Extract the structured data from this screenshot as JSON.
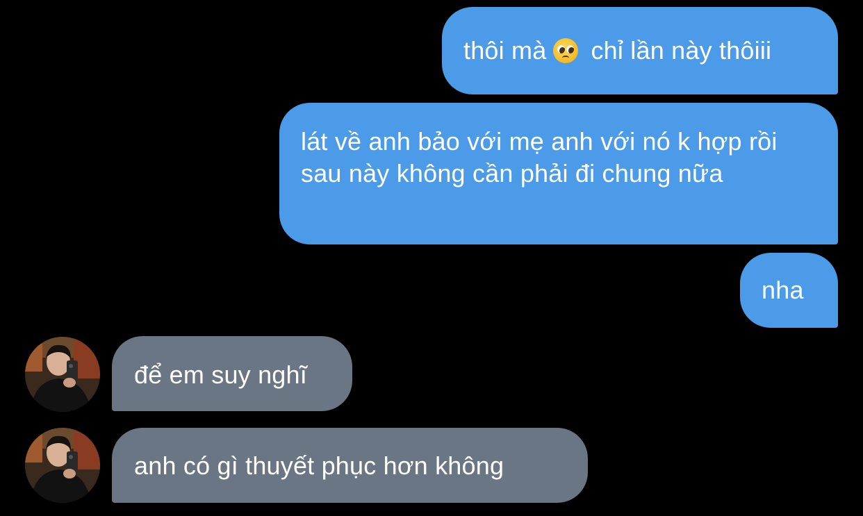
{
  "messages": [
    {
      "id": "b1",
      "direction": "outgoing",
      "text_before": "thôi mà",
      "emoji": "pleading-face",
      "text_after": "chỉ lần này thôiii"
    },
    {
      "id": "b2",
      "direction": "outgoing",
      "text": "lát về anh bảo với mẹ anh với nó k hợp rồi sau này không cần phải đi chung nữa"
    },
    {
      "id": "b3",
      "direction": "outgoing",
      "text": "nha"
    },
    {
      "id": "b4",
      "direction": "incoming",
      "text": "để em suy nghĩ",
      "avatar": "contact-avatar"
    },
    {
      "id": "b5",
      "direction": "incoming",
      "text": "anh có gì thuyết phục hơn không",
      "avatar": "contact-avatar"
    }
  ],
  "colors": {
    "background": "#000000",
    "outgoing_bubble": "#4c9be8",
    "incoming_bubble": "#6a7683",
    "text": "#ffffff"
  }
}
